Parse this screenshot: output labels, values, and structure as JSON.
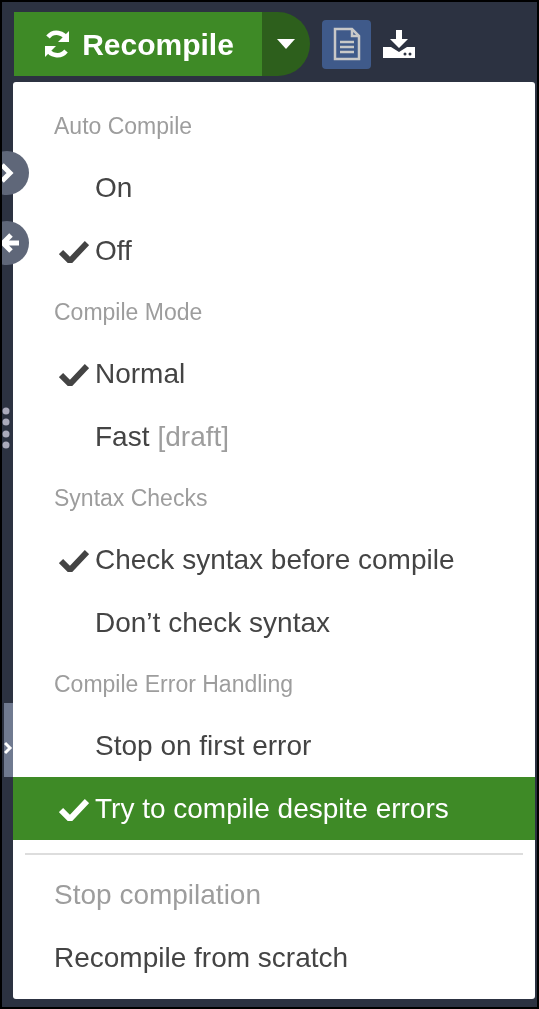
{
  "toolbar": {
    "recompile_button": {
      "label": "Recompile"
    },
    "pdf_button": {
      "selected": true
    }
  },
  "menu": {
    "sections": [
      {
        "header": "Auto Compile",
        "items": [
          {
            "label": "On",
            "checked": false,
            "selected": false
          },
          {
            "label": "Off",
            "checked": true,
            "selected": false
          }
        ]
      },
      {
        "header": "Compile Mode",
        "items": [
          {
            "label": "Normal",
            "checked": true,
            "selected": false
          },
          {
            "label": "Fast",
            "hint": "[draft]",
            "checked": false,
            "selected": false
          }
        ]
      },
      {
        "header": "Syntax Checks",
        "items": [
          {
            "label": "Check syntax before compile",
            "checked": true,
            "selected": false
          },
          {
            "label": "Don’t check syntax",
            "checked": false,
            "selected": false
          }
        ]
      },
      {
        "header": "Compile Error Handling",
        "items": [
          {
            "label": "Stop on first error",
            "checked": false,
            "selected": false
          },
          {
            "label": "Try to compile despite errors",
            "checked": true,
            "selected": true
          }
        ]
      }
    ],
    "actions": [
      {
        "label": "Stop compilation",
        "disabled": true
      },
      {
        "label": "Recompile from scratch",
        "disabled": false
      }
    ]
  }
}
